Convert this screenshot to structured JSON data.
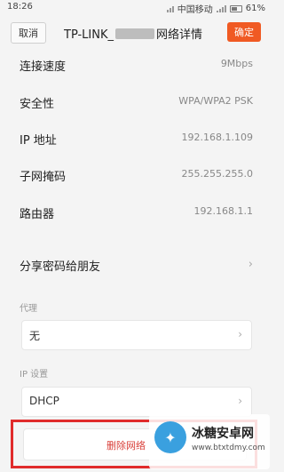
{
  "status_bar": {
    "time": "18:26",
    "carrier": "中国移动",
    "battery": "61%"
  },
  "header": {
    "cancel_label": "取消",
    "title_prefix": "TP-LINK_",
    "title_suffix": "网络详情",
    "confirm_label": "确定"
  },
  "details": [
    {
      "label": "连接速度",
      "value": "9Mbps"
    },
    {
      "label": "安全性",
      "value": "WPA/WPA2 PSK"
    },
    {
      "label": "IP 地址",
      "value": "192.168.1.109"
    },
    {
      "label": "子网掩码",
      "value": "255.255.255.0"
    },
    {
      "label": "路由器",
      "value": "192.168.1.1"
    }
  ],
  "share": {
    "label": "分享密码给朋友",
    "icon": "chevron-right-icon"
  },
  "proxy": {
    "section_label": "代理",
    "value": "无"
  },
  "ip_settings": {
    "section_label": "IP 设置",
    "value": "DHCP"
  },
  "delete": {
    "label": "删除网络"
  },
  "watermark": {
    "title": "冰糖安卓网",
    "url": "www.btxtdmy.com"
  },
  "colors": {
    "accent": "#f05a23",
    "highlight": "#e02b2b"
  }
}
